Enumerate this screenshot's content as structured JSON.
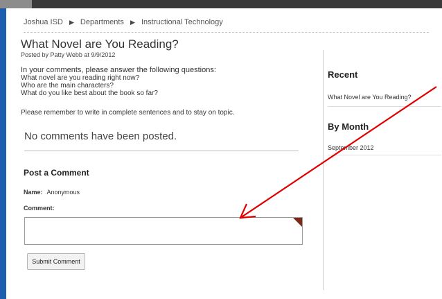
{
  "breadcrumb": {
    "items": [
      "Joshua ISD",
      "Departments",
      "Instructional Technology"
    ],
    "separator": "▶"
  },
  "post": {
    "title": "What Novel are You Reading?",
    "byline": "Posted by Patty Webb at 9/9/2012",
    "intro": "In your comments, please answer the following questions:",
    "questions": [
      "What novel are you reading right now?",
      "Who are the main characters?",
      "What do you like best about the book so far?"
    ],
    "reminder": "Please remember to write in complete sentences and to stay on topic."
  },
  "comments": {
    "empty_text": "No comments have been posted.",
    "form_heading": "Post a Comment",
    "name_label": "Name:",
    "name_value": "Anonymous",
    "comment_label": "Comment:",
    "comment_value": "",
    "submit_label": "Submit Comment"
  },
  "sidebar": {
    "recent_heading": "Recent",
    "recent_items": [
      "What Novel are You Reading?"
    ],
    "by_month_heading": "By Month",
    "month_items": [
      "September 2012"
    ]
  },
  "colors": {
    "left_accent": "#1d5fae",
    "top_bar": "#3a3a3a",
    "annotation_arrow": "#e00000",
    "corner_marker": "#7a2a18"
  }
}
